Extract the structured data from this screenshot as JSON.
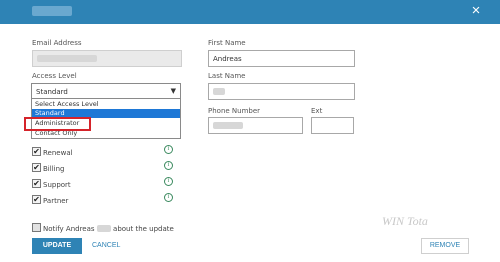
{
  "header": {
    "close_icon": "×"
  },
  "form": {
    "email": {
      "label": "Email Address"
    },
    "access_level": {
      "label": "Access Level",
      "value": "Standard",
      "arrow": "▼",
      "options": [
        "Select Access Level",
        "Standard",
        "Administrator",
        "Contact Only"
      ],
      "highlighted_option": "Standard"
    },
    "first_name": {
      "label": "First Name",
      "value": "Andreas"
    },
    "last_name": {
      "label": "Last Name"
    },
    "phone": {
      "label": "Phone Number"
    },
    "ext": {
      "label": "Ext"
    },
    "permissions": [
      {
        "label": "Renewal",
        "checked": true
      },
      {
        "label": "Billing",
        "checked": true
      },
      {
        "label": "Support",
        "checked": true
      },
      {
        "label": "Partner",
        "checked": true
      }
    ],
    "notify": {
      "prefix": "Notify Andreas",
      "suffix": "about the update",
      "checked": false
    }
  },
  "actions": {
    "update": "UPDATE",
    "cancel": "CANCEL",
    "remove": "REMOVE"
  },
  "watermark": "WIN Tota",
  "colors": {
    "accent": "#2e83b5",
    "highlight": "#d5232a",
    "selected_option": "#1e78d6"
  }
}
